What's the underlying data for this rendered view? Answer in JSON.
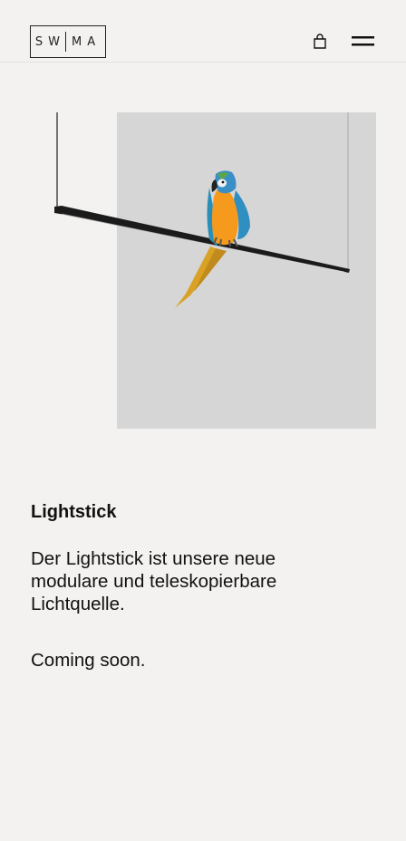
{
  "header": {
    "logo_left": "SW",
    "logo_right": "MA",
    "bag_icon": "shopping-bag-icon",
    "menu_icon": "hamburger-menu-icon"
  },
  "product": {
    "title": "Lightstick",
    "description": "Der Lightstick ist unsere neue modulare und teleskopierbare Lichtquelle.",
    "status": "Coming soon."
  },
  "colors": {
    "background": "#f3f2f0",
    "image_panel": "#d6d6d6",
    "text": "#111111"
  }
}
